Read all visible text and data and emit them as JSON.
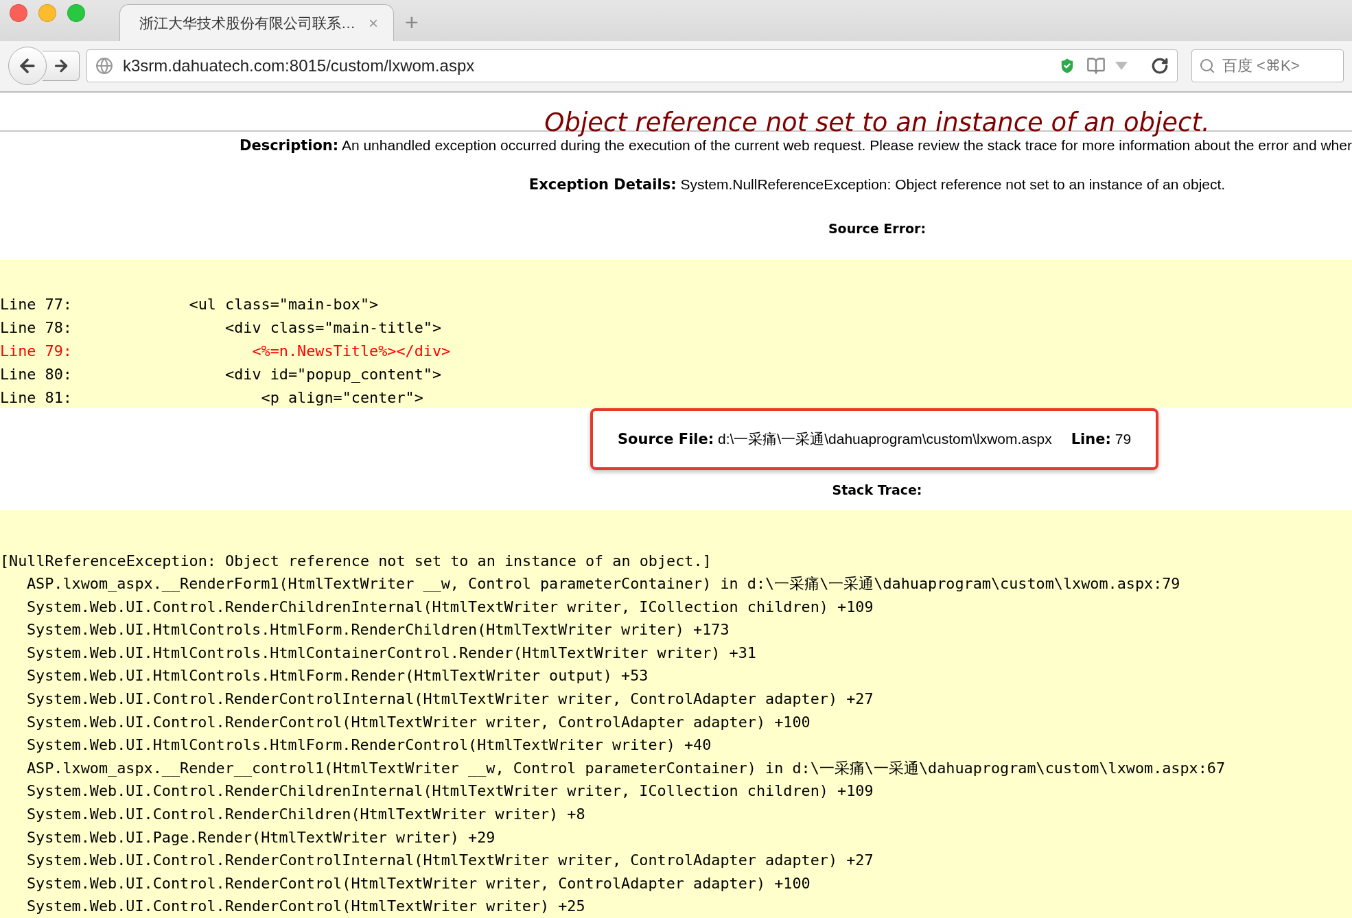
{
  "browser": {
    "tab": {
      "title": "浙江大华技术股份有限公司联系…",
      "close": "×"
    },
    "new_tab": "+",
    "url": "k3srm.dahuatech.com:8015/custom/lxwom.aspx",
    "search": {
      "placeholder": "百度 <⌘K>"
    }
  },
  "error": {
    "title": "Object reference not set to an instance of an object.",
    "description": {
      "label": "Description:",
      "text": "An unhandled exception occurred during the execution of the current web request. Please review the stack trace for more information about the error and wher"
    },
    "exception": {
      "label": "Exception Details:",
      "text": "System.NullReferenceException: Object reference not set to an instance of an object."
    },
    "source_error": {
      "heading": "Source Error:",
      "lines": [
        {
          "text": "Line 77:             <ul class=\"main-box\">",
          "highlighted": false
        },
        {
          "text": "Line 78:                 <div class=\"main-title\">",
          "highlighted": false
        },
        {
          "text": "Line 79:                    <%=n.NewsTitle%></div>",
          "highlighted": true
        },
        {
          "text": "Line 80:                 <div id=\"popup_content\">",
          "highlighted": false
        },
        {
          "text": "Line 81:                     <p align=\"center\">",
          "highlighted": false
        }
      ]
    },
    "source_file": {
      "label": "Source File:",
      "path": "d:\\一采痛\\一采通\\dahuaprogram\\custom\\lxwom.aspx",
      "line_label": "Line:",
      "line": "79"
    },
    "stack_trace": {
      "heading": "Stack Trace:",
      "lines": [
        {
          "kind": "exception",
          "text": "[NullReferenceException: Object reference not set to an instance of an object.]"
        },
        {
          "kind": "frame",
          "text": "ASP.lxwom_aspx.__RenderForm1(HtmlTextWriter __w, Control parameterContainer) in d:\\一采痛\\一采通\\dahuaprogram\\custom\\lxwom.aspx:79"
        },
        {
          "kind": "frame",
          "text": "System.Web.UI.Control.RenderChildrenInternal(HtmlTextWriter writer, ICollection children) +109"
        },
        {
          "kind": "frame",
          "text": "System.Web.UI.HtmlControls.HtmlForm.RenderChildren(HtmlTextWriter writer) +173"
        },
        {
          "kind": "frame",
          "text": "System.Web.UI.HtmlControls.HtmlContainerControl.Render(HtmlTextWriter writer) +31"
        },
        {
          "kind": "frame",
          "text": "System.Web.UI.HtmlControls.HtmlForm.Render(HtmlTextWriter output) +53"
        },
        {
          "kind": "frame",
          "text": "System.Web.UI.Control.RenderControlInternal(HtmlTextWriter writer, ControlAdapter adapter) +27"
        },
        {
          "kind": "frame",
          "text": "System.Web.UI.Control.RenderControl(HtmlTextWriter writer, ControlAdapter adapter) +100"
        },
        {
          "kind": "frame",
          "text": "System.Web.UI.HtmlControls.HtmlForm.RenderControl(HtmlTextWriter writer) +40"
        },
        {
          "kind": "frame",
          "text": "ASP.lxwom_aspx.__Render__control1(HtmlTextWriter __w, Control parameterContainer) in d:\\一采痛\\一采通\\dahuaprogram\\custom\\lxwom.aspx:67"
        },
        {
          "kind": "frame",
          "text": "System.Web.UI.Control.RenderChildrenInternal(HtmlTextWriter writer, ICollection children) +109"
        },
        {
          "kind": "frame",
          "text": "System.Web.UI.Control.RenderChildren(HtmlTextWriter writer) +8"
        },
        {
          "kind": "frame",
          "text": "System.Web.UI.Page.Render(HtmlTextWriter writer) +29"
        },
        {
          "kind": "frame",
          "text": "System.Web.UI.Control.RenderControlInternal(HtmlTextWriter writer, ControlAdapter adapter) +27"
        },
        {
          "kind": "frame",
          "text": "System.Web.UI.Control.RenderControl(HtmlTextWriter writer, ControlAdapter adapter) +100"
        },
        {
          "kind": "frame",
          "text": "System.Web.UI.Control.RenderControl(HtmlTextWriter writer) +25"
        }
      ]
    }
  }
}
